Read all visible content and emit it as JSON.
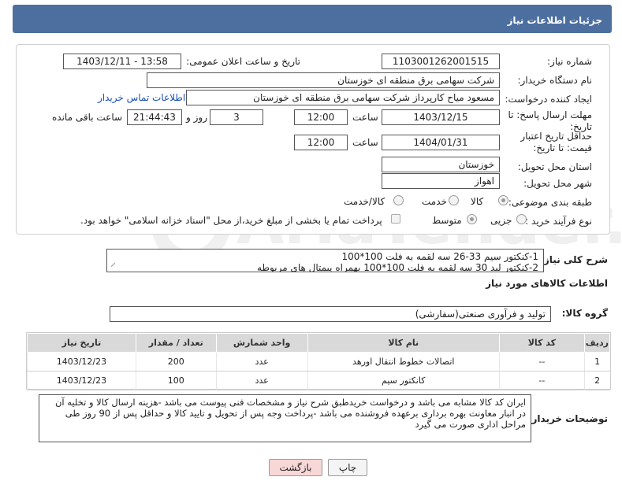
{
  "header": {
    "title": "جزئیات اطلاعات نیاز"
  },
  "form": {
    "need_number_label": "شماره نیاز:",
    "need_number": "1103001262001515",
    "announce_label": "تاریخ و ساعت اعلان عمومی:",
    "announce_value": "1403/12/11 - 13:58",
    "buyer_org_label": "نام دستگاه خریدار:",
    "buyer_org": "شرکت سهامی برق منطقه ای خوزستان",
    "requester_label": "ایجاد کننده درخواست:",
    "requester": "مسعود میاح کارپرداز شرکت سهامی برق منطقه ای خوزستان",
    "contact_link": "اطلاعات تماس خریدار",
    "deadline_label": "مهلت ارسال پاسخ: تا تاریخ:",
    "deadline_date": "1403/12/15",
    "time_label": "ساعت",
    "deadline_time": "12:00",
    "days_value": "3",
    "days_label": "روز و",
    "remaining_time": "21:44:43",
    "remaining_label": "ساعت باقی مانده",
    "validity_label": "حداقل تاریخ اعتبار قیمت: تا تاریخ:",
    "validity_date": "1404/01/31",
    "validity_time": "12:00",
    "province_label": "استان محل تحویل:",
    "province": "خوزستان",
    "city_label": "شهر محل تحویل:",
    "city": "اهواز",
    "category_label": "طبقه بندی موضوعی:",
    "category_options": [
      "کالا",
      "خدمت",
      "کالا/خدمت"
    ],
    "process_label": "نوع فرآیند خرید :",
    "process_options": [
      "جزیی",
      "متوسط"
    ],
    "payment_note": "پرداخت تمام یا بخشی از مبلغ خرید،از محل \"اسناد خزانه اسلامی\" خواهد بود."
  },
  "summary": {
    "label": "شرح کلی نیاز:",
    "line1": "1-کنکتور سیم 33-26 سه لقمه به فلت 100*100",
    "line2": "2-کنکتور لید 30 سه لقمه به فلت 100*100 بهمراه پیمتال های مربوطه"
  },
  "goods": {
    "section_title": "اطلاعات کالاهای مورد نیاز",
    "group_label": "گروه کالا:",
    "group_value": "تولید و فرآوری صنعتی(سفارشی)",
    "columns": [
      "ردیف",
      "کد کالا",
      "نام کالا",
      "واحد شمارش",
      "تعداد / مقدار",
      "تاریخ نیاز"
    ],
    "rows": [
      [
        "1",
        "--",
        "اتصالات خطوط انتقال اورهد",
        "عدد",
        "200",
        "1403/12/23"
      ],
      [
        "2",
        "--",
        "کانکتور سیم",
        "عدد",
        "100",
        "1403/12/23"
      ]
    ]
  },
  "buyer_notes": {
    "label": "توضیحات خریدار:",
    "text": "ایران کد کالا مشابه می باشد و درخواست خریدطبق شرح نیاز و مشخصات فنی پیوست می باشد -هزینه ارسال  کالا و تخلیه آن در انبار معاونت بهره برداری برعهده فروشنده می باشد -پرداخت وجه پس از تحویل و تایید کالا و حداقل پس از 90 روز طی مراحل اداری صورت می گیرد"
  },
  "buttons": {
    "print": "چاپ",
    "back": "بازگشت"
  },
  "watermark": {
    "text": "AriaTender.neT"
  },
  "colors": {
    "header": "#4d6fa0",
    "link": "#1a4fb5",
    "back_button": "#f8d7d7"
  }
}
